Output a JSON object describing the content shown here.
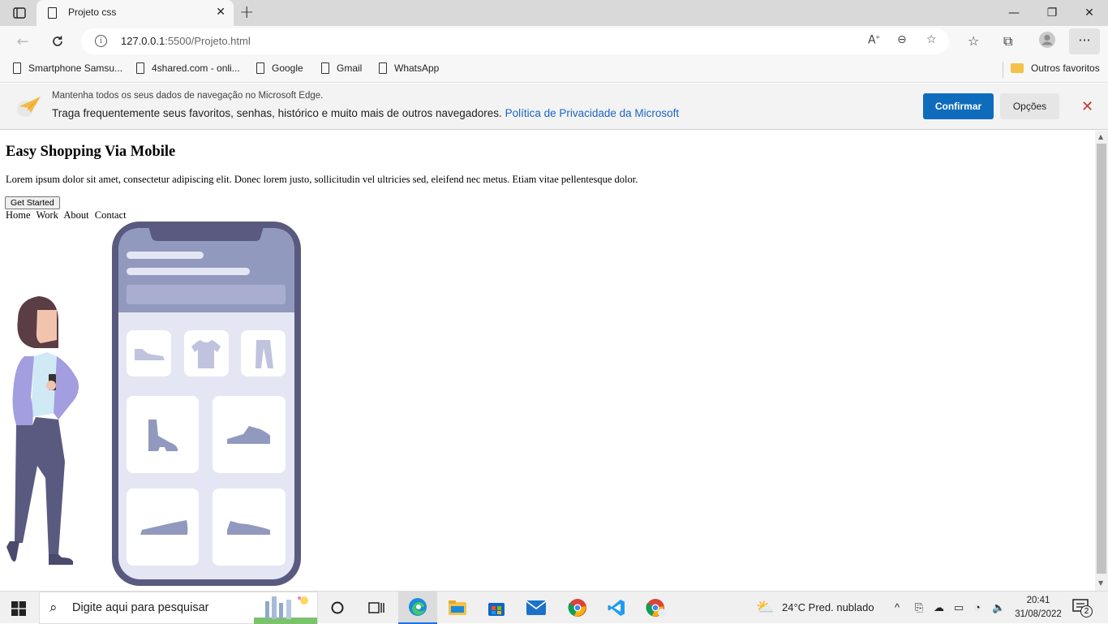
{
  "browser": {
    "tab_title": "Projeto css",
    "url_host": "127.0.0.1",
    "url_rest": ":5500/Projeto.html",
    "favorites": [
      "Smartphone Samsu...",
      "4shared.com - onli...",
      "Google",
      "Gmail",
      "WhatsApp"
    ],
    "other_favorites": "Outros favoritos"
  },
  "infobar": {
    "line1": "Mantenha todos os seus dados de navegação no Microsoft Edge.",
    "line2": "Traga frequentemente seus favoritos, senhas, histórico e muito mais de outros navegadores.",
    "link": "Política de Privacidade da Microsoft",
    "confirm_label": "Confirmar",
    "options_label": "Opções"
  },
  "page": {
    "heading": "Easy Shopping Via Mobile",
    "paragraph": "Lorem ipsum dolor sit amet, consectetur adipiscing elit. Donec lorem justo, sollicitudin vel ultricies sed, eleifend nec metus. Etiam vitae pellentesque dolor.",
    "button_label": "Get Started",
    "nav_links": [
      "Home",
      "Work",
      "About",
      "Contact"
    ]
  },
  "taskbar": {
    "search_placeholder": "Digite aqui para pesquisar",
    "weather": "24°C  Pred. nublado",
    "time": "20:41",
    "date": "31/08/2022",
    "notification_count": "2"
  },
  "colors": {
    "accent": "#0f6cbd",
    "phone_frame": "#5a5a80",
    "phone_header": "#9299bf",
    "phone_screen": "#e4e6f3",
    "jacket": "#a29ee0",
    "pants": "#5a5a80"
  }
}
